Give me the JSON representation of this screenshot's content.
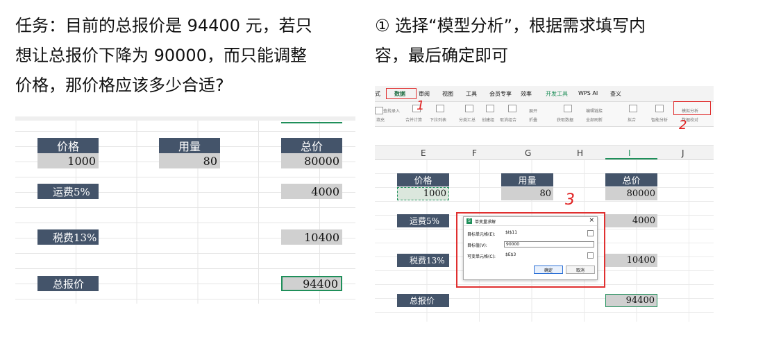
{
  "task": {
    "line1": "任务：目前的总报价是 94400 元，若只",
    "line2": "想让总报价下降为 90000，而只能调整",
    "line3": "价格，那价格应该多少合适?"
  },
  "steps": {
    "line1": "① 选择“模型分析”，根据需求填写内",
    "line2": "容，最后确定即可"
  },
  "left_sheet": {
    "header_price": "价格",
    "header_qty": "用量",
    "header_total": "总价",
    "price": "1000",
    "qty": "80",
    "total": "80000",
    "freight_label": "运费5%",
    "freight_value": "4000",
    "tax_label": "税费13%",
    "tax_value": "10400",
    "grand_label": "总报价",
    "grand_value": "94400"
  },
  "ribbon": {
    "tabs": [
      "式",
      "数据",
      "审阅",
      "视图",
      "工具",
      "会员专享",
      "效率",
      "开发工具",
      "WPS AI",
      "查义"
    ],
    "items": [
      "查找录入",
      "填充",
      "合并计算",
      "下拉列表",
      "分类汇总",
      "创建组",
      "取消组合",
      "展开",
      "折叠",
      "获取数据",
      "编辑链接",
      "全部刷新",
      "拟合",
      "智能分析",
      "模拟分析",
      "数据校对"
    ]
  },
  "right_sheet": {
    "columns": [
      "E",
      "F",
      "G",
      "H",
      "I",
      "J"
    ],
    "header_price": "价格",
    "header_qty": "用量",
    "header_total": "总价",
    "price": "1000",
    "qty": "80",
    "total": "80000",
    "freight_label": "运费5%",
    "freight_value": "4000",
    "tax_label": "税费13%",
    "tax_value": "10400",
    "grand_label": "总报价",
    "grand_value": "94400"
  },
  "dialog": {
    "title": "单变量求解",
    "target_cell_label": "目标单元格(E):",
    "target_cell_value": "$I$11",
    "target_value_label": "目标值(V):",
    "target_value": "90000",
    "variable_cell_label": "可变单元格(C):",
    "variable_cell_value": "$E$3",
    "ok": "确定",
    "cancel": "取消",
    "close": "×"
  },
  "annotations": {
    "step1": "1",
    "step2": "2",
    "step3": "3"
  },
  "colors": {
    "header_fill": "#44546a",
    "value_fill": "#d0d0d0",
    "selection_green": "#1f8f5a",
    "annotation_red": "#e02020"
  }
}
